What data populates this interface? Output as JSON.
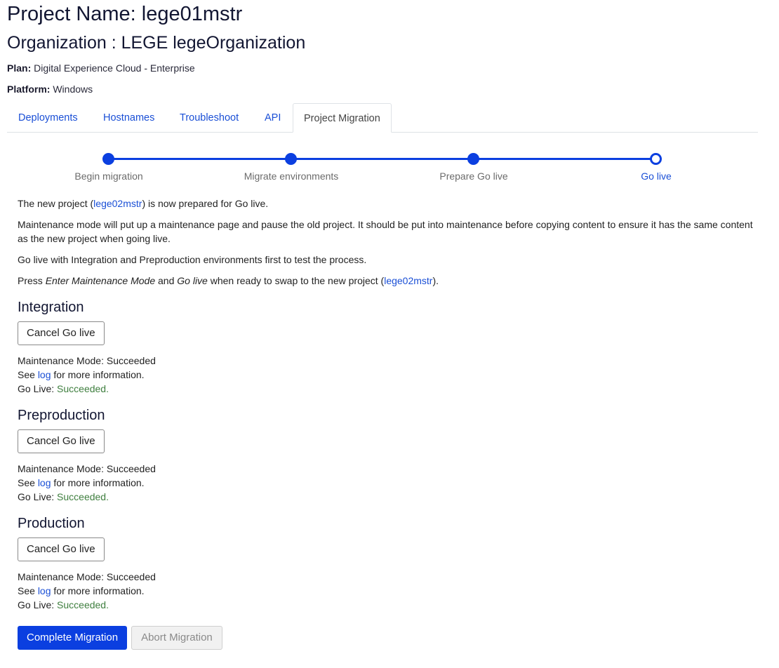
{
  "header": {
    "project_name": "Project Name: lege01mstr",
    "organization": "Organization : LEGE legeOrganization",
    "plan_label": "Plan:",
    "plan_value": "Digital Experience Cloud - Enterprise",
    "platform_label": "Platform:",
    "platform_value": "Windows"
  },
  "tabs": [
    {
      "label": "Deployments"
    },
    {
      "label": "Hostnames"
    },
    {
      "label": "Troubleshoot"
    },
    {
      "label": "API"
    },
    {
      "label": "Project Migration",
      "active": true
    }
  ],
  "stepper": {
    "steps": [
      {
        "label": "Begin migration",
        "done": true
      },
      {
        "label": "Migrate environments",
        "done": true
      },
      {
        "label": "Prepare Go live",
        "done": true
      },
      {
        "label": "Go live",
        "current": true
      }
    ]
  },
  "intro": {
    "p1_before": "The new project (",
    "p1_link": "lege02mstr",
    "p1_after": ") is now prepared for Go live.",
    "p2": "Maintenance mode will put up a maintenance page and pause the old project. It should be put into maintenance before copying content to ensure it has the same content as the new project when going live.",
    "p3": "Go live with Integration and Preproduction environments first to test the process.",
    "p4_a": "Press ",
    "p4_em1": "Enter Maintenance Mode",
    "p4_b": " and ",
    "p4_em2": "Go live",
    "p4_c": " when ready to swap to the new project (",
    "p4_link": "lege02mstr",
    "p4_d": ")."
  },
  "environments": [
    {
      "title": "Integration",
      "button": "Cancel Go live",
      "maintenance": "Maintenance Mode: Succeeded",
      "see": "See ",
      "log": "log",
      "more": " for more information.",
      "golive_label": "Go Live: ",
      "golive_value": "Succeeded."
    },
    {
      "title": "Preproduction",
      "button": "Cancel Go live",
      "maintenance": "Maintenance Mode: Succeeded",
      "see": "See ",
      "log": "log",
      "more": " for more information.",
      "golive_label": "Go Live: ",
      "golive_value": "Succeeded."
    },
    {
      "title": "Production",
      "button": "Cancel Go live",
      "maintenance": "Maintenance Mode: Succeeded",
      "see": "See ",
      "log": "log",
      "more": " for more information.",
      "golive_label": "Go Live: ",
      "golive_value": "Succeeded."
    }
  ],
  "actions": {
    "complete": "Complete Migration",
    "abort": "Abort Migration"
  },
  "colors": {
    "accent": "#0b3fe0",
    "link": "#1a4fd6",
    "success": "#3f7f3f"
  }
}
